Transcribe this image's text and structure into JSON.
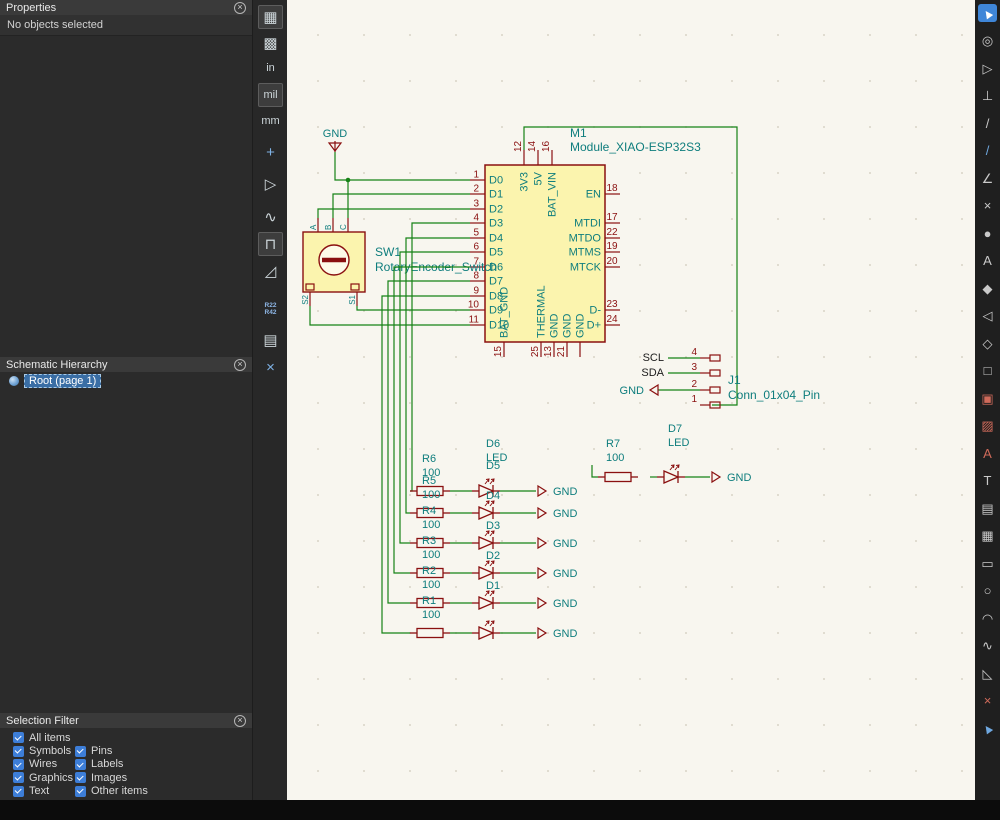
{
  "colors": {
    "wire": "#168216",
    "outline": "#8a1010",
    "fill": "#fbf4ae",
    "pin_number": "#8a1010",
    "pin_name": "#0e7d7d",
    "reference": "#0e7d7d",
    "net_label": "#1c1c1c",
    "selection": "#3f86d8"
  },
  "panels": {
    "properties": {
      "title": "Properties",
      "empty_text": "No objects selected"
    },
    "hierarchy": {
      "title": "Schematic Hierarchy",
      "root_label": "Root (page 1)"
    },
    "selection_filter": {
      "title": "Selection Filter",
      "rows": [
        [
          "All items"
        ],
        [
          "Symbols",
          "Pins"
        ],
        [
          "Wires",
          "Labels"
        ],
        [
          "Graphics",
          "Images"
        ],
        [
          "Text",
          "Other items"
        ]
      ]
    }
  },
  "left_toolbar": {
    "buttons": [
      {
        "name": "grid-settings-button",
        "glyph": "▦",
        "cls": "active"
      },
      {
        "name": "grid-overrides-button",
        "glyph": "▩"
      },
      {
        "name": "unit-inches-button",
        "glyph": "in",
        "cls": "unit"
      },
      {
        "name": "unit-mils-button",
        "glyph": "mil",
        "cls": "unit active"
      },
      {
        "name": "unit-mm-button",
        "glyph": "mm",
        "cls": "unit"
      },
      {
        "name": "crosshair-cursor-button",
        "glyph": "+",
        "cls": "bluish"
      },
      {
        "name": "free-angle-mode-button",
        "glyph": "▷"
      },
      {
        "name": "sim-sine-button",
        "glyph": "∿"
      },
      {
        "name": "sim-step-button",
        "glyph": "⊓",
        "cls": "active"
      },
      {
        "name": "sim-ramp-button",
        "glyph": "◿"
      },
      {
        "name": "annotate-button",
        "stack": [
          "R22",
          "R42"
        ],
        "cls": "small-stack"
      },
      {
        "name": "sheet-properties-button",
        "glyph": "▤"
      },
      {
        "name": "tools-button",
        "glyph": "×",
        "cls": "bluish"
      }
    ]
  },
  "right_toolbar": {
    "buttons": [
      {
        "name": "select-tool-button",
        "glyph": "▲",
        "cls": "selected",
        "rot": true
      },
      {
        "name": "highlight-net-button",
        "glyph": "◎"
      },
      {
        "name": "add-symbol-button",
        "glyph": "▷"
      },
      {
        "name": "add-power-port-button",
        "glyph": "⊥"
      },
      {
        "name": "add-wire-button",
        "glyph": "/"
      },
      {
        "name": "add-bus-button",
        "glyph": "/",
        "cls": "blue"
      },
      {
        "name": "wire-to-bus-entry-button",
        "glyph": "∠"
      },
      {
        "name": "no-connect-button",
        "glyph": "×"
      },
      {
        "name": "add-junction-button",
        "glyph": "●"
      },
      {
        "name": "net-label-button",
        "glyph": "A"
      },
      {
        "name": "directive-label-button",
        "glyph": "◆"
      },
      {
        "name": "global-label-button",
        "glyph": "◁"
      },
      {
        "name": "hierarchical-label-button",
        "glyph": "◇"
      },
      {
        "name": "add-sheet-button",
        "glyph": "□"
      },
      {
        "name": "sheet-pin-button",
        "glyph": "▣",
        "cls": "red"
      },
      {
        "name": "place-image-button",
        "glyph": "▨",
        "cls": "red"
      },
      {
        "name": "text-variable-button",
        "glyph": "A",
        "cls": "red"
      },
      {
        "name": "text-button",
        "glyph": "T"
      },
      {
        "name": "text-box-button",
        "glyph": "▤"
      },
      {
        "name": "table-button",
        "glyph": "▦"
      },
      {
        "name": "rectangle-button",
        "glyph": "▭"
      },
      {
        "name": "circle-button",
        "glyph": "○"
      },
      {
        "name": "arc-button",
        "glyph": "◠"
      },
      {
        "name": "bezier-button",
        "glyph": "∿"
      },
      {
        "name": "ruler-button",
        "glyph": "◺"
      },
      {
        "name": "delete-tool-button",
        "glyph": "×",
        "cls": "red"
      },
      {
        "name": "drag-tool-button",
        "glyph": "▲",
        "cls": "blue",
        "rot": true
      }
    ]
  },
  "schematic": {
    "power": {
      "gnd_top": "GND"
    },
    "mcu": {
      "reference": "M1",
      "value": "Module_XIAO-ESP32S3",
      "left_pins": [
        {
          "num": "1",
          "name": "D0"
        },
        {
          "num": "2",
          "name": "D1"
        },
        {
          "num": "3",
          "name": "D2"
        },
        {
          "num": "4",
          "name": "D3"
        },
        {
          "num": "5",
          "name": "D4"
        },
        {
          "num": "6",
          "name": "D5"
        },
        {
          "num": "7",
          "name": "D6"
        },
        {
          "num": "8",
          "name": "D7"
        },
        {
          "num": "9",
          "name": "D8"
        },
        {
          "num": "10",
          "name": "D9"
        },
        {
          "num": "11",
          "name": "D10"
        }
      ],
      "top_pins": [
        {
          "num": "12",
          "name": "3V3"
        },
        {
          "num": "14",
          "name": "5V"
        },
        {
          "num": "16",
          "name": "BAT_VIN"
        }
      ],
      "right_pins": [
        {
          "num": "18",
          "name": "EN"
        },
        {
          "num": "17",
          "name": "MTDI"
        },
        {
          "num": "22",
          "name": "MTDO"
        },
        {
          "num": "19",
          "name": "MTMS"
        },
        {
          "num": "20",
          "name": "MTCK"
        },
        {
          "num": "23",
          "name": "D-"
        },
        {
          "num": "24",
          "name": "D+"
        }
      ],
      "bottom_pins": [
        {
          "num": "15",
          "name": "BAT_GND"
        },
        {
          "num": "25",
          "name": "THERMAL"
        },
        {
          "num": "13",
          "name": "GND"
        },
        {
          "num": "21",
          "name": "GND"
        },
        {
          "num": "",
          "name": "GND"
        }
      ]
    },
    "encoder": {
      "reference": "SW1",
      "value": "RotaryEncoder_Switch",
      "top_pin_labels": [
        "A",
        "B",
        "C"
      ],
      "bottom_pin_labels": [
        "S2",
        "S1"
      ]
    },
    "connector": {
      "reference": "J1",
      "value": "Conn_01x04_Pin",
      "gnd_label": "GND",
      "pins": [
        {
          "num": "4",
          "net": "SCL"
        },
        {
          "num": "3",
          "net": "SDA"
        },
        {
          "num": "2",
          "net": ""
        },
        {
          "num": "1",
          "net": ""
        }
      ]
    },
    "led_rows": [
      {
        "res_ref": "R6",
        "res_val": "100",
        "led_ref": "D6",
        "led_val": "LED",
        "gnd": "GND"
      },
      {
        "res_ref": "R5",
        "res_val": "100",
        "led_ref": "D5",
        "led_val": "",
        "gnd": "GND"
      },
      {
        "res_ref": "R4",
        "res_val": "100",
        "led_ref": "D4",
        "led_val": "",
        "gnd": "GND"
      },
      {
        "res_ref": "R3",
        "res_val": "100",
        "led_ref": "D3",
        "led_val": "",
        "gnd": "GND"
      },
      {
        "res_ref": "R2",
        "res_val": "100",
        "led_ref": "D2",
        "led_val": "",
        "gnd": "GND"
      },
      {
        "res_ref": "R1",
        "res_val": "100",
        "led_ref": "D1",
        "led_val": "",
        "gnd": "GND"
      }
    ],
    "r7_row": {
      "res_ref": "R7",
      "res_val": "100",
      "led_ref": "D7",
      "led_val": "LED",
      "gnd": "GND"
    }
  }
}
